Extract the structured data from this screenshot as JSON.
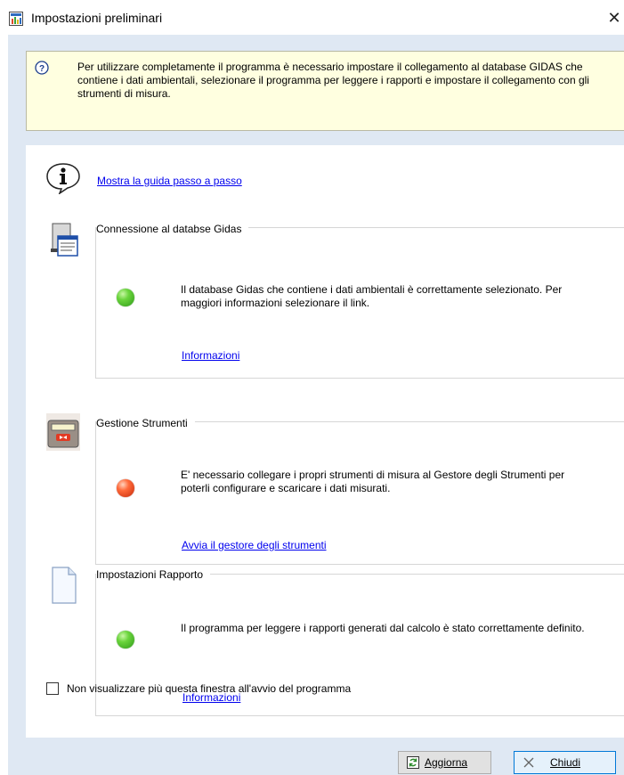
{
  "window": {
    "title": "Impostazioni preliminari",
    "close_glyph": "✕"
  },
  "banner": {
    "icon": "help-icon",
    "text": "Per utilizzare completamente il programma è necessario impostare il collegamento al database GIDAS che contiene i dati ambientali, selezionare il programma per leggere i rapporti e impostare il collegamento con gli strumenti di misura."
  },
  "guide": {
    "icon": "info-icon",
    "link": "Mostra la guida passo a passo"
  },
  "sections": [
    {
      "title": "Connessione al databse Gidas",
      "icon": "database-server-icon",
      "status": "ok",
      "status_color": "#3cb52a",
      "description": "Il database Gidas che contiene i dati ambientali è correttamente selezionato. Per maggiori informazioni selezionare il link.",
      "link": "Informazioni"
    },
    {
      "title": "Gestione Strumenti",
      "icon": "instrument-icon",
      "status": "error",
      "status_color": "#e8441c",
      "description": "E' necessario collegare i propri strumenti di misura al Gestore degli Strumenti per poterli configurare e scaricare i dati misurati.",
      "link": "Avvia il gestore degli strumenti"
    },
    {
      "title": "Impostazioni Rapporto",
      "icon": "document-icon",
      "status": "ok",
      "status_color": "#3cb52a",
      "description": "Il programma per leggere i rapporti generati dal calcolo è stato correttamente definito.",
      "link": "Informazioni"
    }
  ],
  "checkbox": {
    "label": "Non visualizzare più questa finestra all'avvio del programma",
    "checked": false
  },
  "buttons": {
    "refresh_label": "Aggiorna",
    "close_label": "Chiudi"
  },
  "colors": {
    "client_background": "#dfe8f3",
    "banner_background": "#ffffe0",
    "link": "#0000ee"
  }
}
